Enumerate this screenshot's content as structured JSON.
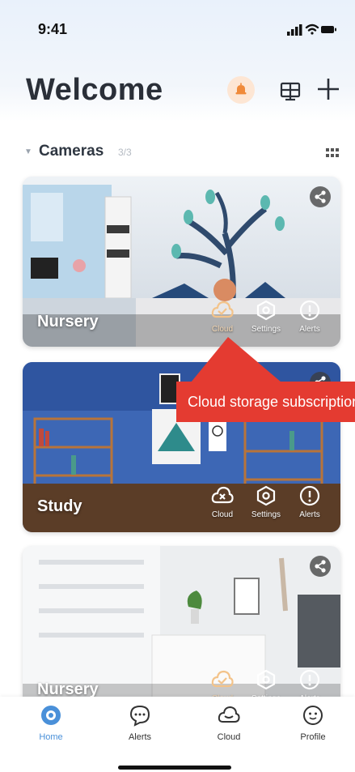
{
  "status_bar": {
    "time": "9:41"
  },
  "header": {
    "title": "Welcome"
  },
  "section": {
    "title": "Cameras",
    "count": "3/3"
  },
  "cameras": [
    {
      "name": "Nursery",
      "actions": {
        "cloud": "Cloud",
        "settings": "Settings",
        "alerts": "Alerts"
      }
    },
    {
      "name": "Study",
      "actions": {
        "cloud": "Cloud",
        "settings": "Settings",
        "alerts": "Alerts"
      }
    },
    {
      "name": "Nursery",
      "actions": {
        "cloud": "Cloud",
        "settings": "Settings",
        "alerts": "Alerts"
      }
    }
  ],
  "tooltip": {
    "text": "Cloud storage subscription"
  },
  "tabs": [
    {
      "label": "Home",
      "icon": "home-icon",
      "active": true
    },
    {
      "label": "Alerts",
      "icon": "chat-bubble-icon",
      "active": false
    },
    {
      "label": "Cloud",
      "icon": "cloud-icon",
      "active": false
    },
    {
      "label": "Profile",
      "icon": "profile-icon",
      "active": false
    }
  ],
  "colors": {
    "accent": "#4a90d9",
    "callout": "#e43b31",
    "bell_bg": "#fde6d4",
    "cloud_highlight": "#f3d6b3"
  }
}
